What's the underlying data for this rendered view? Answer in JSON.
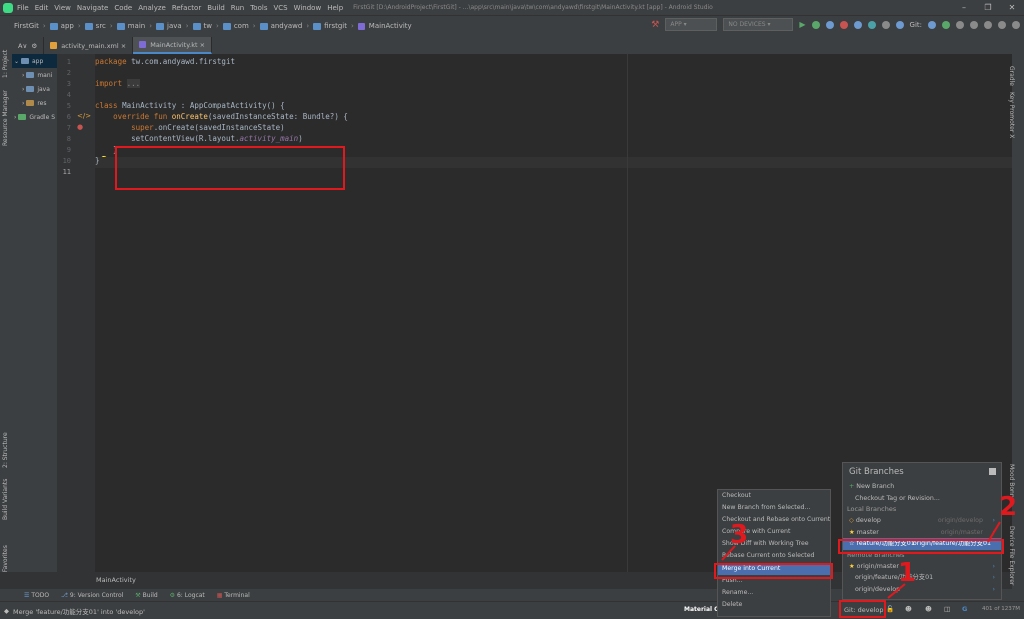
{
  "menu": {
    "items": [
      "File",
      "Edit",
      "View",
      "Navigate",
      "Code",
      "Analyze",
      "Refactor",
      "Build",
      "Run",
      "Tools",
      "VCS",
      "Window",
      "Help"
    ],
    "window_title": "FirstGit [D:\\AndroidProject\\FirstGit] - ...\\app\\src\\main\\java\\tw\\com\\andyawd\\firstgit\\MainActivity.kt [app] - Android Studio"
  },
  "breadcrumb": [
    "FirstGit",
    "app",
    "src",
    "main",
    "java",
    "tw",
    "com",
    "andyawd",
    "firstgit",
    "MainActivity"
  ],
  "toolbar": {
    "config": "APP",
    "devices": "NO DEVICES",
    "git_label": "Git:"
  },
  "tabs": [
    "A∨",
    "activity_main.xml",
    "MainActivity.kt"
  ],
  "project": {
    "items": [
      "app",
      "mani",
      "java",
      "res",
      "Gradle S"
    ]
  },
  "left_strip": {
    "project": "1: Project",
    "resource": "Resource Manager",
    "structure": "2: Structure",
    "build_variants": "Build Variants",
    "favorites": "2: Favorites"
  },
  "right_strip": {
    "gradle": "Gradle",
    "key_promoter": "Key Promoter X",
    "mood": "Mood Bonn",
    "device_file": "Device File Explorer"
  },
  "editor": {
    "line_numbers": [
      "1",
      "2",
      "3",
      "4",
      "5",
      "6",
      "7",
      "8",
      "9",
      "10",
      "11"
    ],
    "code": {
      "package": "tw.com.andyawd.firstgit",
      "import": "...",
      "class_name": "MainActivity",
      "superclass": "AppCompatActivity",
      "method": "onCreate",
      "param": "savedInstanceState: Bundle?",
      "super_call": "super",
      "super_arg": "savedInstanceState",
      "set_cv": "setContentView",
      "layout": "R.layout.",
      "layout_id": "activity_main"
    },
    "breadcrumb_bottom": "MainActivity"
  },
  "bottom_tools": [
    "TODO",
    "9: Version Control",
    "Build",
    "6: Logcat",
    "Terminal"
  ],
  "status": {
    "message": "Merge 'feature/功能分支01' into 'develop'",
    "material": "Material Oc",
    "git_branch": "Git: develop",
    "memory": "401 of 1237M"
  },
  "git_branches": {
    "title": "Git Branches",
    "actions": [
      "New Branch",
      "Checkout Tag or Revision..."
    ],
    "local_header": "Local Branches",
    "local": [
      {
        "name": "develop",
        "remote": "origin/develop"
      },
      {
        "name": "master",
        "remote": "origin/master"
      },
      {
        "name": "feature/功能分支01",
        "remote": "origin/feature/功能分支01"
      }
    ],
    "remote_header": "Remote Branches",
    "remote": [
      "origin/master",
      "origin/feature/功能分支01",
      "origin/develop"
    ]
  },
  "context_menu": [
    "Checkout",
    "New Branch from Selected...",
    "Checkout and Rebase onto Current",
    "Compare with Current",
    "Show Diff with Working Tree",
    "Rebase Current onto Selected",
    "Merge into Current",
    "Push...",
    "Rename...",
    "Delete"
  ],
  "annotations": [
    "1",
    "2",
    "3"
  ]
}
